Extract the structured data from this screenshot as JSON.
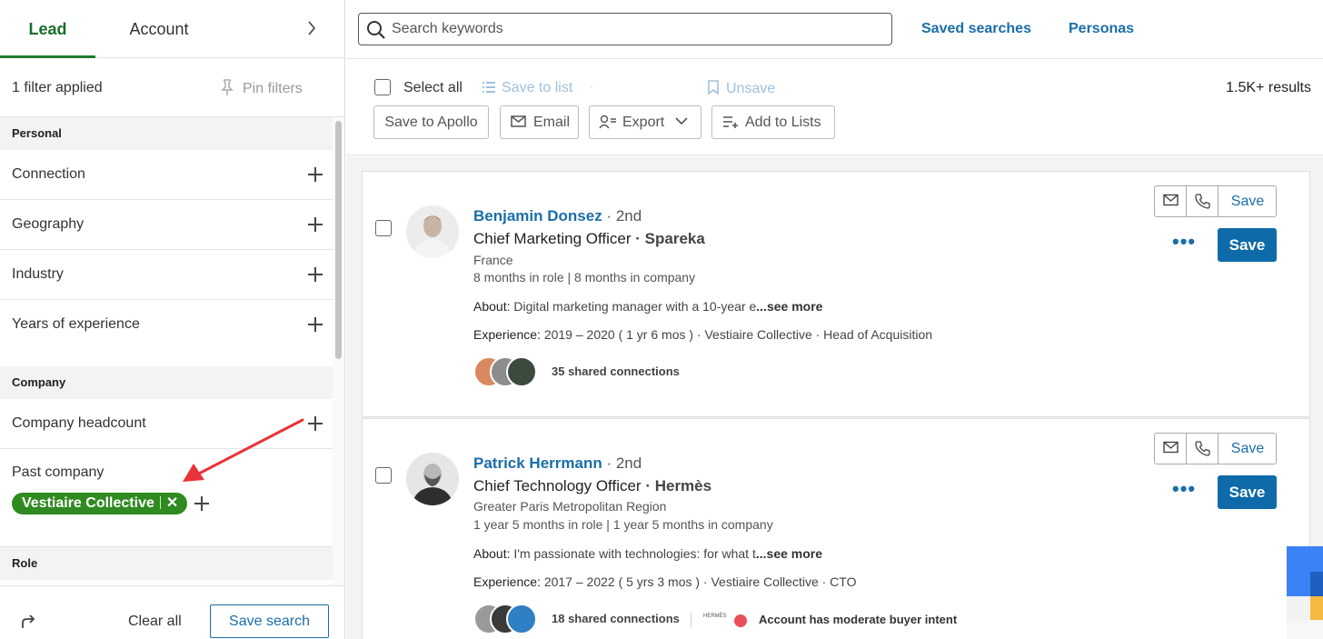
{
  "sidebar": {
    "tabs": {
      "lead": "Lead",
      "account": "Account"
    },
    "filters_applied": "1 filter applied",
    "pin_filters": "Pin filters",
    "sections": {
      "personal": "Personal",
      "company": "Company",
      "role": "Role"
    },
    "personal_filters": [
      "Connection",
      "Geography",
      "Industry",
      "Years of experience"
    ],
    "company_headcount": "Company headcount",
    "past_company": {
      "label": "Past company",
      "chip": "Vestiaire Collective"
    },
    "footer": {
      "clear_all": "Clear all",
      "save_search": "Save search"
    }
  },
  "topbar": {
    "search_placeholder": "Search keywords",
    "saved_searches": "Saved searches",
    "personas": "Personas"
  },
  "toolbar": {
    "select_all": "Select all",
    "save_to_list": "Save to list",
    "unsave": "Unsave",
    "results": "1.5K+ results",
    "buttons": {
      "save_to_apollo": "Save to Apollo",
      "email": "Email",
      "export": "Export",
      "add_to_lists": "Add to Lists"
    }
  },
  "leads": [
    {
      "name": "Benjamin Donsez",
      "degree": "· 2nd",
      "title": "Chief Marketing Officer",
      "company": "· Spareka",
      "location": "France",
      "tenure": "8 months in role | 8 months in company",
      "about_label": "About:",
      "about": "Digital marketing manager with a 10-year e",
      "about_more": "...see more",
      "experience_label": "Experience:",
      "experience": "2019 – 2020 ( 1 yr 6 mos ) · Vestiaire Collective · Head of Acquisition",
      "shared_connections": "35 shared connections",
      "save_label": "Save",
      "save_primary": "Save"
    },
    {
      "name": "Patrick Herrmann",
      "degree": "· 2nd",
      "title": "Chief Technology Officer",
      "company": "· Hermès",
      "location": "Greater Paris Metropolitan Region",
      "tenure": "1 year 5 months in role | 1 year 5 months in company",
      "about_label": "About:",
      "about": "I'm passionate with technologies: for what t",
      "about_more": "...see more",
      "experience_label": "Experience:",
      "experience": "2017 – 2022 ( 5 yrs 3 mos ) · Vestiaire Collective · CTO",
      "shared_connections": "18 shared connections",
      "company_logo_text": "HERMÈS",
      "intent": "Account has moderate buyer intent",
      "save_label": "Save",
      "save_primary": "Save"
    }
  ],
  "colors": {
    "brand_green": "#1f7a2e",
    "chip_green": "#2f8a1f",
    "link_blue": "#1a6ea8",
    "primary_button": "#0e6aa8",
    "annotation_arrow": "#e8333a",
    "intent_dot": "#e84f5b"
  },
  "icons": [
    "chevron-right-icon",
    "pin-icon",
    "plus-icon",
    "share-icon",
    "search-icon",
    "list-icon",
    "bookmark-icon",
    "mail-icon",
    "user-export-icon",
    "chevron-down-icon",
    "add-list-icon",
    "phone-icon",
    "more-icon",
    "close-icon"
  ]
}
